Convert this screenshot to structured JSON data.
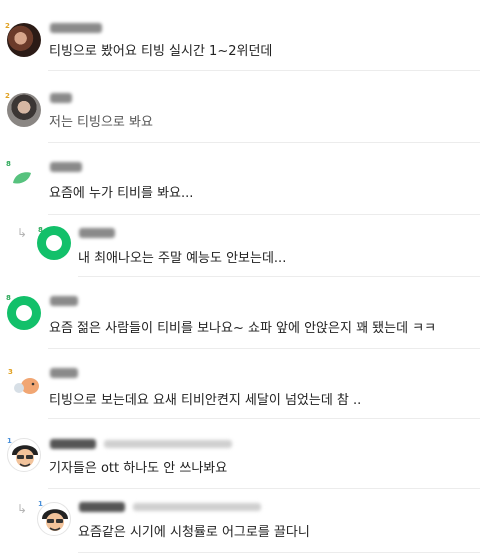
{
  "comments": [
    {
      "level": "2",
      "text": "티빙으로 봤어요 티빙 실시간 1~2위던데"
    },
    {
      "level": "2",
      "text": "저는 티빙으로 봐요"
    },
    {
      "level": "8",
      "text": "요즘에 누가 티비를 봐요..."
    },
    {
      "level": "8",
      "text": "내 최애나오는 주말 예능도 안보는데..."
    },
    {
      "level": "8",
      "text": "요즘 젊은 사람들이 티비를 보나요~ 쇼파 앞에 안앉은지 꽤 됐는데 ㅋㅋ"
    },
    {
      "level": "3",
      "text": "티빙으로 보는데요 요새 티비안켠지 세달이 넘었는데 참 .."
    },
    {
      "level": "1",
      "text": "기자들은 ott 하나도 안 쓰나봐요"
    },
    {
      "level": "1",
      "text": "요즘같은 시기에 시청률로 어그로를 끌다니"
    }
  ],
  "icons": {
    "reply": "reply-arrow-icon",
    "leaf": "leaf-icon"
  },
  "colors": {
    "green_avatar": "#12c06a",
    "level_badge": "#e0a020",
    "divider": "#ececec"
  }
}
